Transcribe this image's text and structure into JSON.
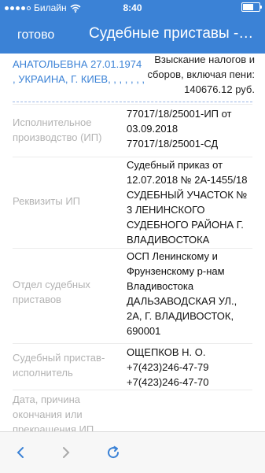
{
  "status_bar": {
    "carrier": "Билайн",
    "time": "8:40",
    "battery_percent": 70
  },
  "nav": {
    "done_label": "готово",
    "title": "Судебные приставы -…"
  },
  "top_entry": {
    "debtor_text": "АНАТОЛЬЕВНА 27.01.1974 , УКРАИНА, Г. КИЕВ, , , , , , ,",
    "subject_text": "Взыскание налогов и сборов, включая пени: 140676.12 руб."
  },
  "rows": [
    {
      "label": "Исполнительное производство (ИП)",
      "value": "77017/18/25001-ИП от 03.09.2018 77017/18/25001-СД"
    },
    {
      "label": "Реквизиты ИП",
      "value": "Судебный приказ от 12.07.2018 № 2А-1455/18 СУДЕБНЫЙ УЧАСТОК № 3 ЛЕНИНСКОГО СУДЕБНОГО РАЙОНА Г. ВЛАДИВОСТОКА"
    },
    {
      "label": "Отдел судебных приставов",
      "value": "ОСП Ленинскому и Фрунзенскому р-нам Владивостока ДАЛЬЗАВОДСКАЯ УЛ., 2А, Г. ВЛАДИВОСТОК, 690001"
    },
    {
      "label": "Судебный пристав-исполнитель",
      "value": "ОЩЕПКОВ Н. О. +7(423)246-47-79 +7(423)246-47-70"
    },
    {
      "label": "Дата, причина окончания или прекращения ИП",
      "value": ""
    }
  ],
  "toolbar": {
    "back_icon": "chevron-left-icon",
    "forward_icon": "chevron-right-icon",
    "reload_icon": "reload-icon"
  },
  "colors": {
    "accent": "#3b82d6",
    "label_gray": "#b3b3b3"
  }
}
